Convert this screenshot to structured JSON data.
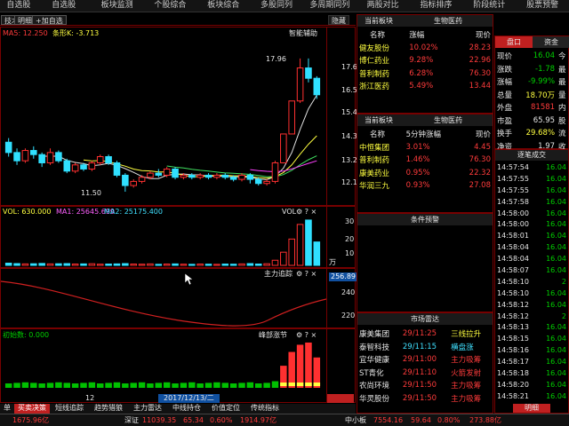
{
  "top_menu": [
    "自选股",
    "自选股",
    "板块监测",
    "个股综合",
    "板块综合",
    "多股同列",
    "多周期同列",
    "两股对比",
    "指标排序",
    "阶段统计",
    "股票预警"
  ],
  "toolbar": {
    "btn1": "技术",
    "btn2": "明细",
    "btn3": "+加自选",
    "right": "隐藏"
  },
  "kline": {
    "ma_label": "MA5: 12.250",
    "ma_label2": "条形K: -3.713",
    "indicator": "智能辅助",
    "high_label": "17.96",
    "low_label": "11.50",
    "yticks": [
      "17.6",
      "16.5",
      "15.4",
      "14.3",
      "13.2",
      "12.1"
    ],
    "candles": [
      {
        "o": 13.9,
        "c": 13.4,
        "h": 14.1,
        "l": 13.2
      },
      {
        "o": 13.4,
        "c": 13.0,
        "h": 13.6,
        "l": 12.8
      },
      {
        "o": 13.0,
        "c": 13.5,
        "h": 13.6,
        "l": 12.9
      },
      {
        "o": 13.5,
        "c": 13.3,
        "h": 13.7,
        "l": 13.1
      },
      {
        "o": 13.3,
        "c": 12.9,
        "h": 13.4,
        "l": 12.7
      },
      {
        "o": 12.9,
        "c": 13.4,
        "h": 13.6,
        "l": 12.8
      },
      {
        "o": 13.4,
        "c": 13.0,
        "h": 13.5,
        "l": 12.9
      },
      {
        "o": 13.0,
        "c": 12.5,
        "h": 13.1,
        "l": 12.4
      },
      {
        "o": 12.5,
        "c": 12.8,
        "h": 12.9,
        "l": 12.4
      },
      {
        "o": 12.8,
        "c": 12.6,
        "h": 12.9,
        "l": 12.5
      },
      {
        "o": 12.6,
        "c": 12.9,
        "h": 13.0,
        "l": 12.5
      },
      {
        "o": 12.9,
        "c": 13.2,
        "h": 13.3,
        "l": 12.8
      },
      {
        "o": 13.2,
        "c": 12.9,
        "h": 13.3,
        "l": 12.8
      },
      {
        "o": 12.9,
        "c": 12.3,
        "h": 13.0,
        "l": 12.2
      },
      {
        "o": 12.3,
        "c": 11.8,
        "h": 12.4,
        "l": 11.5
      },
      {
        "o": 11.8,
        "c": 12.0,
        "h": 12.1,
        "l": 11.7
      },
      {
        "o": 12.0,
        "c": 12.2,
        "h": 12.3,
        "l": 11.9
      },
      {
        "o": 12.2,
        "c": 12.4,
        "h": 12.5,
        "l": 12.1
      },
      {
        "o": 12.4,
        "c": 12.3,
        "h": 12.6,
        "l": 12.2
      },
      {
        "o": 12.3,
        "c": 12.6,
        "h": 12.7,
        "l": 12.2
      },
      {
        "o": 12.6,
        "c": 12.2,
        "h": 12.7,
        "l": 12.1
      },
      {
        "o": 12.2,
        "c": 12.3,
        "h": 12.4,
        "l": 12.1
      },
      {
        "o": 12.3,
        "c": 12.2,
        "h": 12.4,
        "l": 12.1
      },
      {
        "o": 12.2,
        "c": 12.3,
        "h": 12.4,
        "l": 12.1
      },
      {
        "o": 12.3,
        "c": 12.2,
        "h": 12.4,
        "l": 12.1
      },
      {
        "o": 12.2,
        "c": 12.3,
        "h": 12.4,
        "l": 12.1
      },
      {
        "o": 12.3,
        "c": 12.2,
        "h": 12.4,
        "l": 12.1
      },
      {
        "o": 12.2,
        "c": 12.1,
        "h": 12.3,
        "l": 12.0
      },
      {
        "o": 12.1,
        "c": 12.3,
        "h": 12.4,
        "l": 12.0
      },
      {
        "o": 12.3,
        "c": 12.1,
        "h": 12.4,
        "l": 11.9
      },
      {
        "o": 12.1,
        "c": 11.9,
        "h": 12.2,
        "l": 11.8
      },
      {
        "o": 11.9,
        "c": 12.0,
        "h": 12.1,
        "l": 11.8
      },
      {
        "o": 12.0,
        "c": 12.9,
        "h": 13.0,
        "l": 11.9
      },
      {
        "o": 12.9,
        "c": 14.3,
        "h": 14.3,
        "l": 12.9
      },
      {
        "o": 14.3,
        "c": 15.9,
        "h": 15.9,
        "l": 14.3
      },
      {
        "o": 15.9,
        "c": 17.5,
        "h": 17.96,
        "l": 15.8
      },
      {
        "o": 17.5,
        "c": 17.0,
        "h": 17.96,
        "l": 16.8
      },
      {
        "o": 17.0,
        "c": 16.2,
        "h": 17.1,
        "l": 16.0
      }
    ]
  },
  "vol": {
    "label": "VOL: 630.000",
    "ma1": "MA1: 25645.699",
    "ma2": "MA2: 25175.400",
    "title": "VOL",
    "yticks": [
      "30",
      "20",
      "10"
    ],
    "unit": "万",
    "values": [
      1.5,
      1.2,
      1.0,
      1.1,
      1.3,
      1.0,
      1.1,
      1.2,
      0.9,
      1.0,
      1.1,
      0.8,
      0.9,
      1.0,
      1.2,
      0.9,
      0.8,
      1.0,
      0.7,
      0.9,
      1.0,
      0.8,
      0.7,
      0.9,
      0.8,
      0.7,
      0.9,
      0.8,
      1.0,
      1.2,
      0.9,
      1.1,
      3.5,
      9.0,
      18.0,
      28.0,
      31.0,
      16.0
    ]
  },
  "osc": {
    "title": "主力追踪",
    "val": "256.89",
    "yticks": [
      "240",
      "220"
    ]
  },
  "sig": {
    "label": "初始数: 0.000",
    "title": "峰部涨节",
    "values": [
      0.8,
      0.9,
      1.0,
      0.9,
      0.8,
      0.9,
      1.0,
      0.9,
      0.8,
      0.9,
      1.0,
      0.8,
      0.9,
      1.0,
      0.8,
      0.9,
      1.0,
      0.8,
      0.9,
      1.0,
      0.8,
      0.9,
      1.0,
      0.8,
      0.9,
      1.0,
      0.9,
      0.8,
      0.9,
      1.0,
      0.8,
      0.9,
      1.2,
      4.0,
      6.5,
      7.8,
      8.2,
      5.5
    ]
  },
  "date_label": "2017/12/13/二",
  "date_left": "12",
  "sector1": {
    "title": "当前板块",
    "sector": "生物医药",
    "cols": [
      "名称",
      "涨幅",
      "现价"
    ],
    "rows": [
      [
        "健友股份",
        "10.02%",
        "28.23"
      ],
      [
        "博仁药业",
        "9.28%",
        "22.96"
      ],
      [
        "普利制药",
        "6.28%",
        "76.30"
      ],
      [
        "浙江医药",
        "5.49%",
        "13.44"
      ]
    ]
  },
  "sector2": {
    "title": "当前板块",
    "sector": "生物医药",
    "cols": [
      "名称",
      "5分钟涨幅",
      "现价"
    ],
    "rows": [
      [
        "中恒集团",
        "3.01%",
        "4.45"
      ],
      [
        "普利制药",
        "1.46%",
        "76.30"
      ],
      [
        "康美药业",
        "0.95%",
        "22.32"
      ],
      [
        "华润三九",
        "0.93%",
        "27.08"
      ]
    ]
  },
  "cond": {
    "title": "条件预警"
  },
  "radar": {
    "title": "市场雷达",
    "rows": [
      [
        "康美集团",
        "29/11:25",
        "三线拉升"
      ],
      [
        "泰智科技",
        "29/11:15",
        "横盘涨"
      ],
      [
        "宜华健康",
        "29/11:00",
        "主力吸筹"
      ],
      [
        "ST青化",
        "29/11:10",
        "火箭发射"
      ],
      [
        "农尚环境",
        "29/11:50",
        "主力吸筹"
      ],
      [
        "华灵股份",
        "29/11:50",
        "主力吸筹"
      ]
    ]
  },
  "quote": {
    "tab1": "盘口",
    "tab2": "资金",
    "rows": [
      [
        "现价",
        "16.04",
        "今"
      ],
      [
        "涨跌",
        "-1.78",
        "最"
      ],
      [
        "涨幅",
        "-9.99%",
        "最"
      ],
      [
        "总量",
        "18.70万",
        "量"
      ],
      [
        "外盘",
        "81581",
        "内"
      ]
    ]
  },
  "quote2": {
    "rows": [
      [
        "市盈",
        "65.95",
        "股"
      ],
      [
        "换手",
        "29.68%",
        "流"
      ],
      [
        "净资",
        "1.97",
        "收"
      ]
    ]
  },
  "ticks": {
    "title": "逐笔成交",
    "rows": [
      [
        "14:57:54",
        "16.04"
      ],
      [
        "14:57:55",
        "16.04"
      ],
      [
        "14:57:55",
        "16.04"
      ],
      [
        "14:57:58",
        "16.04"
      ],
      [
        "14:58:00",
        "16.04"
      ],
      [
        "14:58:00",
        "16.04"
      ],
      [
        "14:58:01",
        "16.04"
      ],
      [
        "14:58:04",
        "16.04"
      ],
      [
        "14:58:04",
        "16.04"
      ],
      [
        "14:58:07",
        "16.04"
      ],
      [
        "14:58:10",
        "2"
      ],
      [
        "14:58:10",
        "16.04"
      ],
      [
        "14:58:12",
        "16.04"
      ],
      [
        "14:58:12",
        "2"
      ],
      [
        "14:58:13",
        "16.04"
      ],
      [
        "14:58:15",
        "16.04"
      ],
      [
        "14:58:16",
        "16.04"
      ],
      [
        "14:58:17",
        "16.04"
      ],
      [
        "14:58:18",
        "16.04"
      ],
      [
        "14:58:20",
        "16.04"
      ],
      [
        "14:58:21",
        "16.04"
      ]
    ],
    "btn": "明细"
  },
  "bottom_tabs": [
    "单",
    "买卖决策",
    "短线追踪",
    "趋势猎狼",
    "主力雷达",
    "中线持仓",
    "价值定位",
    "传统指标"
  ],
  "bottom_bar": {
    "a": "1675.96亿",
    "b": "深证",
    "c": "11039.35",
    "d": "65.34",
    "e": "0.60%",
    "f": "1914.97亿",
    "g": "中小板",
    "h": "7554.16",
    "i": "59.64",
    "j": "0.80%",
    "k": "273.88亿"
  }
}
